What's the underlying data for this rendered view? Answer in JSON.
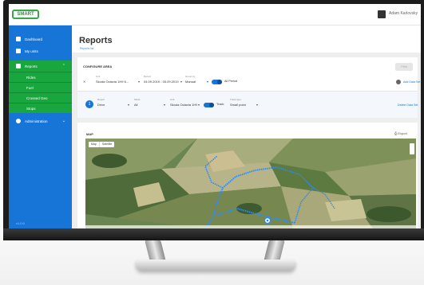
{
  "app": {
    "logo_text": "SMART",
    "user_name": "Adam Karlovsky"
  },
  "sidebar": {
    "items": [
      {
        "label": "Dashboard",
        "icon": "speedometer-icon"
      },
      {
        "label": "My units",
        "icon": "car-icon"
      },
      {
        "label": "Reports",
        "icon": "report-icon"
      },
      {
        "label": "Administration",
        "icon": "gear-icon"
      }
    ],
    "sub_items": [
      "Rides",
      "Fuel",
      "Crossed Geo",
      "Stops"
    ],
    "version": "v1.0.0"
  },
  "page": {
    "title": "Reports",
    "subtitle": "Reports list"
  },
  "filters": {
    "heading": "CONFIGURE AREA",
    "print_label": "Print",
    "row1": {
      "unit_label": "Unit",
      "unit_value": "Skoda Octavia 1H9 6...",
      "period_label": "Period",
      "period_value": "04.09.2019 - 05.09.2019",
      "group_label": "Group by",
      "group_value": "Manual",
      "toggle_label": "All Period",
      "link": "Add Data Set"
    },
    "row2": {
      "number": "1",
      "report_label": "Report",
      "report_value": "Drive",
      "mode_label": "Mode",
      "mode_value": "All",
      "unit_label": "Unit",
      "unit_value": "Skoda Octavia 1H9 6...",
      "toggle_label": "Track",
      "type_label": "Track type",
      "type_value": "Small point",
      "link": "Delete Data Set"
    }
  },
  "map": {
    "heading": "MAP",
    "export_label": "Export",
    "tabs": [
      "Map",
      "Satellite"
    ]
  },
  "colors": {
    "sidebar": "#1675d6",
    "sidebar_active": "#19a63f",
    "route": "#2a8bff"
  }
}
